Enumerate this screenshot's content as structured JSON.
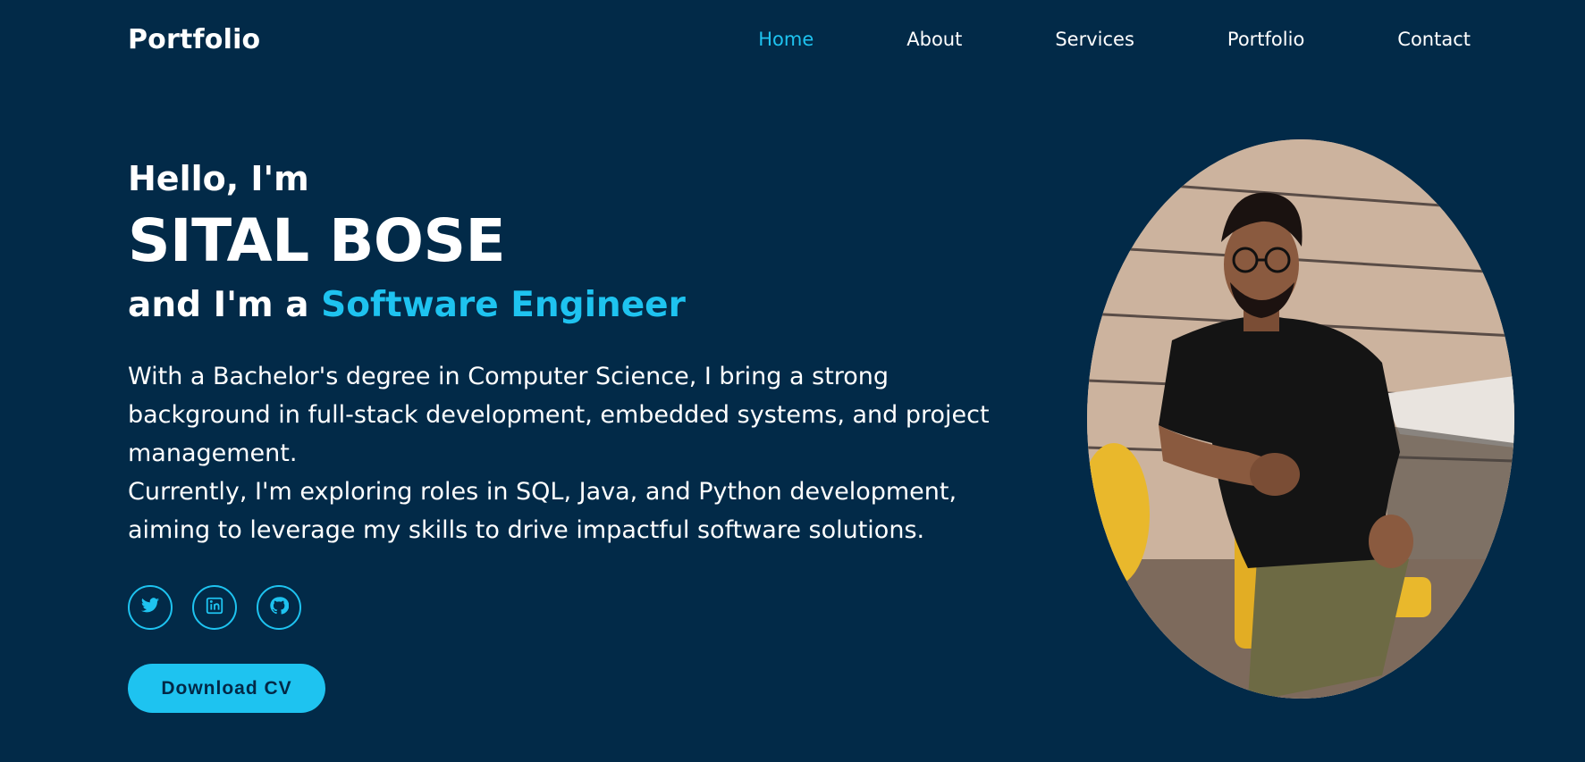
{
  "header": {
    "logo": "Portfolio",
    "nav": [
      {
        "label": "Home",
        "active": true
      },
      {
        "label": "About",
        "active": false
      },
      {
        "label": "Services",
        "active": false
      },
      {
        "label": "Portfolio",
        "active": false
      },
      {
        "label": "Contact",
        "active": false
      }
    ]
  },
  "hero": {
    "greeting": "Hello, I'm",
    "name": "SITAL BOSE",
    "role_prefix": "and I'm a ",
    "role": "Software Engineer",
    "bio": [
      "With a Bachelor's degree in Computer Science, I bring a strong background in full-stack development, embedded systems, and project management.",
      "Currently, I'm exploring roles in SQL, Java, and Python development, aiming to leverage my skills to drive impactful software solutions."
    ],
    "socials": [
      {
        "icon": "twitter-icon"
      },
      {
        "icon": "linkedin-icon"
      },
      {
        "icon": "github-icon"
      }
    ],
    "cta_label": "Download CV"
  },
  "colors": {
    "background": "#022a48",
    "accent": "#1ec3f0",
    "text": "#ffffff"
  }
}
